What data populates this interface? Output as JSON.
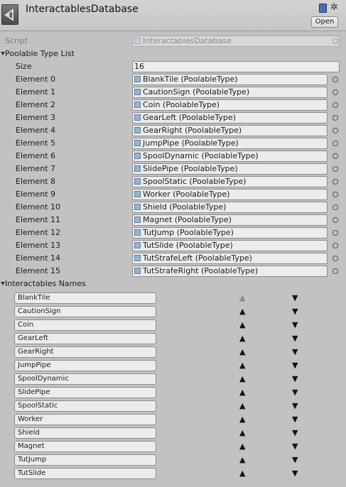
{
  "header": {
    "title": "InteractablesDatabase",
    "open_label": "Open",
    "icons": [
      "unity-asset-icon",
      "help-book-icon",
      "gear-icon"
    ]
  },
  "script_row": {
    "label": "Script",
    "value": "InteractablesDatabase"
  },
  "poolable_list": {
    "label": "Poolable Type List",
    "size_label": "Size",
    "size_value": "16",
    "elements": [
      {
        "label": "Element 0",
        "value": "BlankTile (PoolableType)"
      },
      {
        "label": "Element 1",
        "value": "CautionSign (PoolableType)"
      },
      {
        "label": "Element 2",
        "value": "Coin (PoolableType)"
      },
      {
        "label": "Element 3",
        "value": "GearLeft (PoolableType)"
      },
      {
        "label": "Element 4",
        "value": "GearRight (PoolableType)"
      },
      {
        "label": "Element 5",
        "value": "JumpPipe (PoolableType)"
      },
      {
        "label": "Element 6",
        "value": "SpoolDynamic (PoolableType)"
      },
      {
        "label": "Element 7",
        "value": "SlidePipe (PoolableType)"
      },
      {
        "label": "Element 8",
        "value": "SpoolStatic (PoolableType)"
      },
      {
        "label": "Element 9",
        "value": "Worker (PoolableType)"
      },
      {
        "label": "Element 10",
        "value": "Shield (PoolableType)"
      },
      {
        "label": "Element 11",
        "value": "Magnet (PoolableType)"
      },
      {
        "label": "Element 12",
        "value": "TutJump (PoolableType)"
      },
      {
        "label": "Element 13",
        "value": "TutSlide (PoolableType)"
      },
      {
        "label": "Element 14",
        "value": "TutStrafeLeft (PoolableType)"
      },
      {
        "label": "Element 15",
        "value": "TutStrafeRight (PoolableType)"
      }
    ]
  },
  "interactables_names": {
    "label": "Interactables Names",
    "up_glyph": "▲",
    "down_glyph": "▼",
    "items": [
      "BlankTile",
      "CautionSign",
      "Coin",
      "GearLeft",
      "GearRight",
      "JumpPipe",
      "SpoolDynamic",
      "SlidePipe",
      "SpoolStatic",
      "Worker",
      "Shield",
      "Magnet",
      "TutJump",
      "TutSlide"
    ]
  },
  "colors": {
    "background": "#c2c2c2",
    "field": "#ececec",
    "object_icon": "#9ab3cf"
  }
}
